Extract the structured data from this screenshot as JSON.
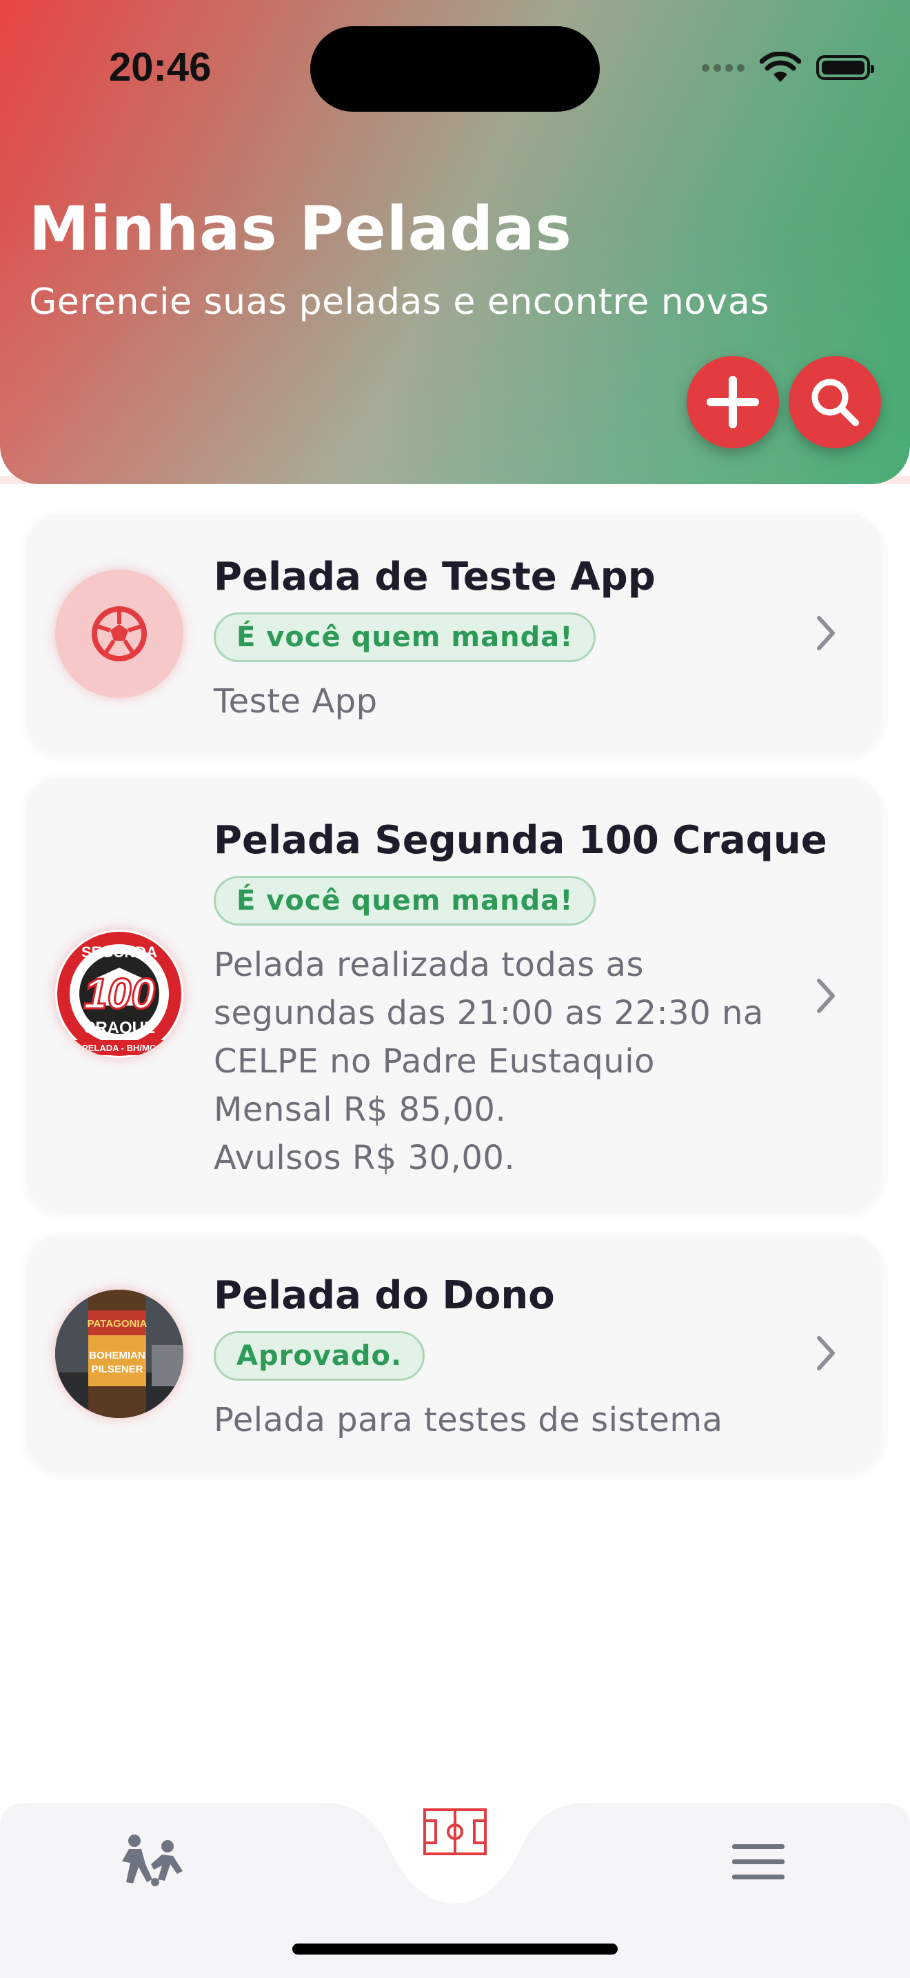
{
  "status_bar": {
    "time": "20:46"
  },
  "header": {
    "title": "Minhas Peladas",
    "subtitle": "Gerencie suas peladas e encontre novas",
    "actions": [
      {
        "name": "add",
        "icon": "plus-icon"
      },
      {
        "name": "search",
        "icon": "search-icon"
      }
    ]
  },
  "peladas": [
    {
      "title": "Pelada de Teste App",
      "badge": "É você quem manda!",
      "description": "Teste App",
      "avatar": "soccer-ball-icon"
    },
    {
      "title": "Pelada Segunda 100 Craque",
      "badge": "É você quem manda!",
      "description": "Pelada realizada todas as segundas das 21:00 as 22:30 na CELPE no Padre Eustaquio\nMensal R$ 85,00.\nAvulsos R$ 30,00.",
      "avatar": "segunda-100-craque-logo",
      "logo_text": {
        "top": "SEGUNDA",
        "number": "100",
        "middle": "CRAQUE",
        "bottom": "PELADA - BH/MG"
      }
    },
    {
      "title": "Pelada do Dono",
      "badge": "Aprovado.",
      "description": "Pelada para testes de sistema",
      "avatar": "beer-bottle-photo",
      "photo_text": {
        "brand": "PATAGONIA",
        "line1": "BOHEMIAN",
        "line2": "PILSENER"
      }
    }
  ],
  "bottom_nav": [
    {
      "name": "players",
      "icon": "players-icon"
    },
    {
      "name": "field",
      "icon": "soccer-field-icon",
      "active": true
    },
    {
      "name": "menu",
      "icon": "hamburger-menu-icon"
    }
  ],
  "colors": {
    "accent": "#e33c40",
    "badge_text": "#2d9a58",
    "gradient_start": "#e84545",
    "gradient_end": "#3aa66a"
  }
}
